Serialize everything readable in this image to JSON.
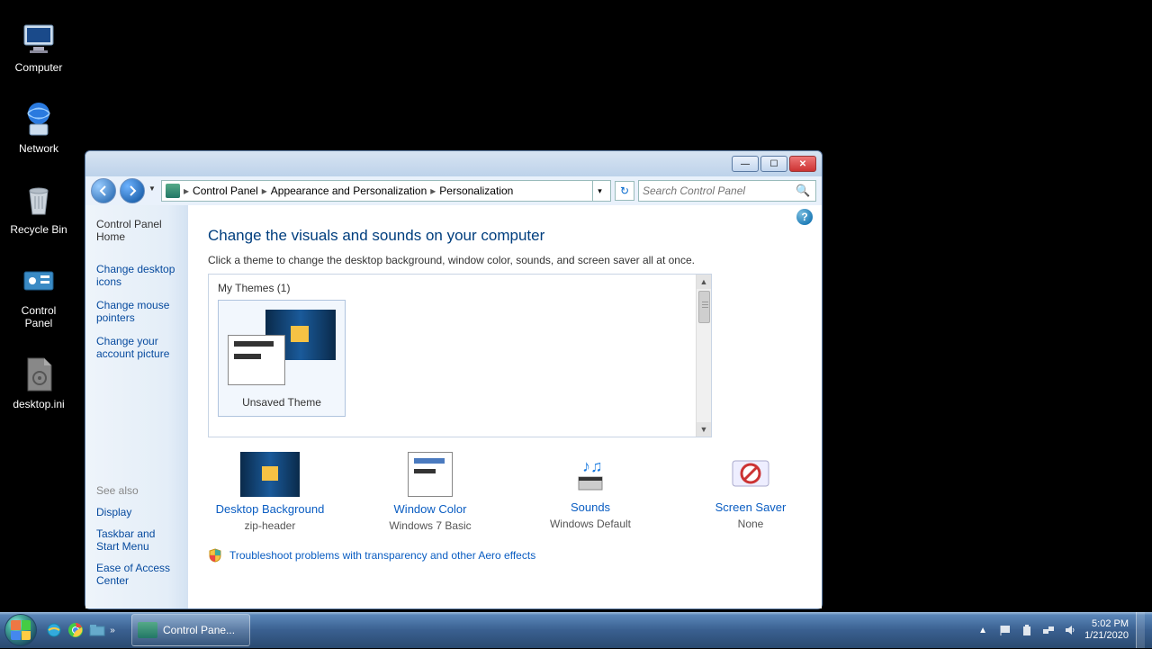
{
  "desktop": {
    "icons": [
      {
        "name": "Computer"
      },
      {
        "name": "Network"
      },
      {
        "name": "Recycle Bin"
      },
      {
        "name": "Control Panel"
      },
      {
        "name": "desktop.ini"
      }
    ]
  },
  "window": {
    "breadcrumb": {
      "items": [
        "Control Panel",
        "Appearance and Personalization",
        "Personalization"
      ]
    },
    "search_placeholder": "Search Control Panel",
    "sidebar": {
      "home": "Control Panel Home",
      "links": [
        "Change desktop icons",
        "Change mouse pointers",
        "Change your account picture"
      ],
      "see_also_label": "See also",
      "see_also": [
        "Display",
        "Taskbar and Start Menu",
        "Ease of Access Center"
      ]
    },
    "main": {
      "title": "Change the visuals and sounds on your computer",
      "subtitle": "Click a theme to change the desktop background, window color, sounds, and screen saver all at once.",
      "my_themes_label": "My Themes (1)",
      "theme_name": "Unsaved Theme",
      "options": [
        {
          "label": "Desktop Background",
          "value": "zip-header"
        },
        {
          "label": "Window Color",
          "value": "Windows 7 Basic"
        },
        {
          "label": "Sounds",
          "value": "Windows Default"
        },
        {
          "label": "Screen Saver",
          "value": "None"
        }
      ],
      "troubleshoot": "Troubleshoot problems with transparency and other Aero effects"
    }
  },
  "taskbar": {
    "active_window": "Control Pane...",
    "time": "5:02 PM",
    "date": "1/21/2020"
  }
}
